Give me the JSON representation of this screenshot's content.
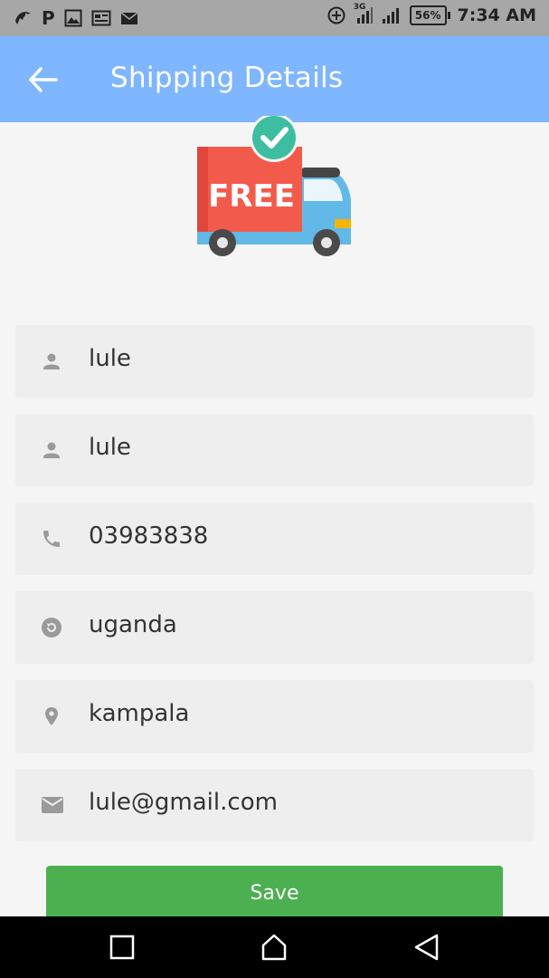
{
  "status_bar": {
    "time": "7:34 AM",
    "battery": "56%",
    "network": "3G",
    "left_icons": [
      "bird-icon",
      "p-icon",
      "image-icon",
      "news-icon",
      "mail-icon"
    ],
    "p_glyph": "P"
  },
  "app_bar": {
    "title": "Shipping Details",
    "color": "#7eb6ff"
  },
  "illustration": {
    "label": "FREE"
  },
  "form": {
    "fields": [
      {
        "icon": "person-icon",
        "value": "lule"
      },
      {
        "icon": "person-icon",
        "value": "lule"
      },
      {
        "icon": "phone-icon",
        "value": "03983838"
      },
      {
        "icon": "history-icon",
        "value": "uganda"
      },
      {
        "icon": "location-pin-icon",
        "value": "kampala"
      },
      {
        "icon": "email-icon",
        "value": "lule@gmail.com"
      }
    ],
    "save_label": "Save",
    "save_color": "#4caf50"
  },
  "nav_bar": {
    "buttons": [
      "recent-apps-icon",
      "home-icon",
      "back-triangle-icon"
    ]
  }
}
